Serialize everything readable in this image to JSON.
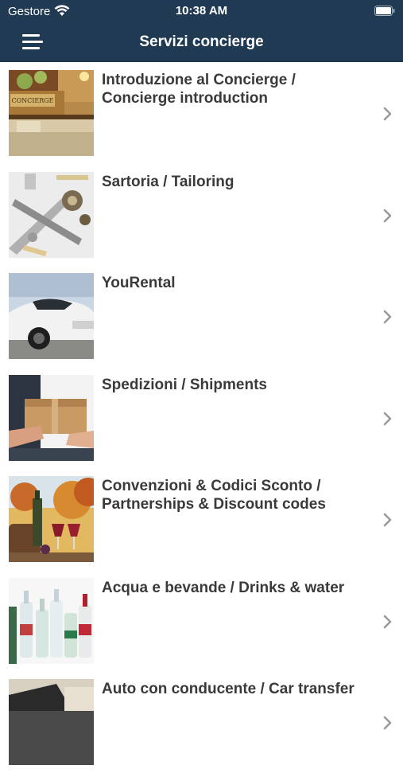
{
  "status_bar": {
    "carrier": "Gestore",
    "time": "10:38 AM"
  },
  "nav": {
    "title": "Servizi concierge",
    "menu_icon": "hamburger-menu-icon"
  },
  "colors": {
    "bar": "#1f3a52",
    "text": "#3a3a3a",
    "chevron": "#9a9a9a"
  },
  "services": [
    {
      "title": "Introduzione al Concierge / Concierge introduction",
      "image": "concierge-desk-photo",
      "sign_text": "CONCIERGE"
    },
    {
      "title": "Sartoria / Tailoring",
      "image": "tailoring-tools-photo"
    },
    {
      "title": "YouRental",
      "image": "sports-car-photo"
    },
    {
      "title": "Spedizioni / Shipments",
      "image": "parcel-delivery-photo"
    },
    {
      "title": "Convenzioni & Codici Sconto / Partnerships & Discount codes",
      "image": "wine-and-vineyard-photo"
    },
    {
      "title": "Acqua e bevande / Drinks & water",
      "image": "water-bottles-photo"
    },
    {
      "title": "Auto con conducente / Car transfer",
      "image": "car-interior-photo"
    }
  ]
}
